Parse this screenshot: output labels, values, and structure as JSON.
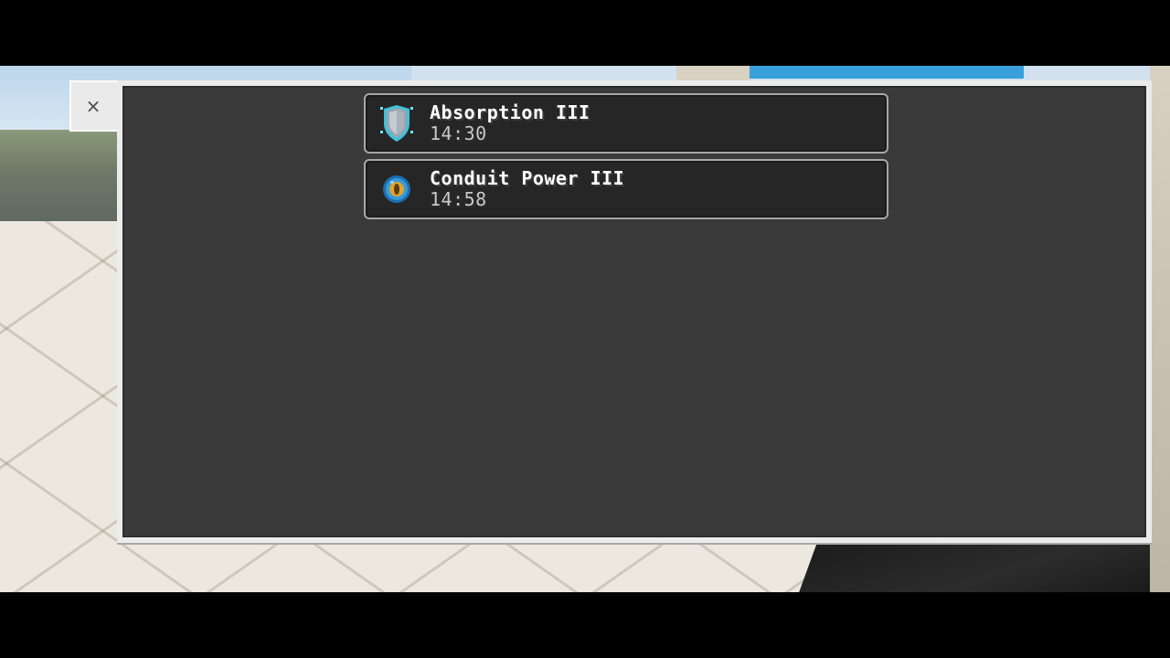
{
  "close_button": {
    "icon": "close-icon",
    "glyph": "×"
  },
  "effects": [
    {
      "name": "Absorption III",
      "time": "14:30",
      "icon": "absorption-shield-icon"
    },
    {
      "name": "Conduit Power III",
      "time": "14:58",
      "icon": "conduit-power-orb-icon"
    }
  ],
  "colors": {
    "panel_frame": "#ebebeb",
    "panel_bg": "#3a3a3a",
    "row_bg": "#262626",
    "row_border": "#a7a7a7",
    "name_text": "#ffffff",
    "time_text": "#c9c9c9"
  }
}
